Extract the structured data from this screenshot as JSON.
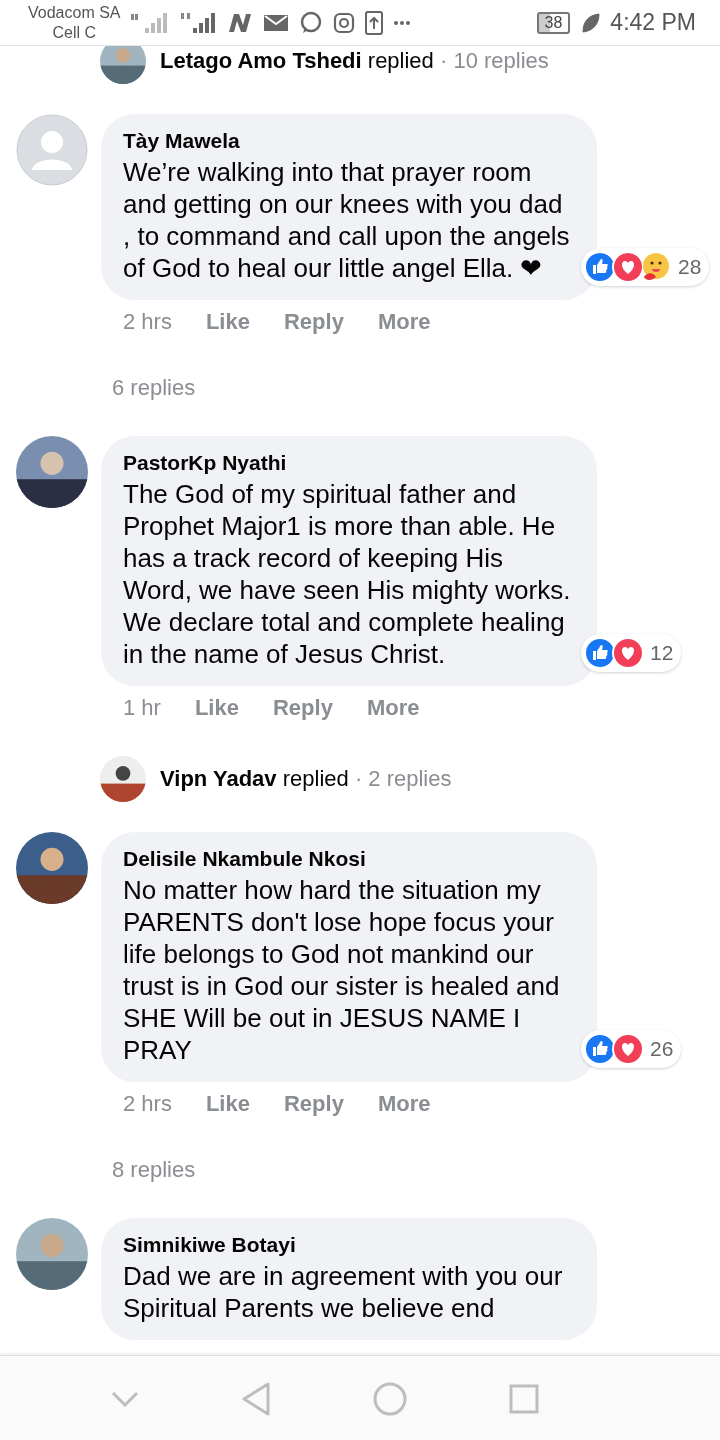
{
  "status_bar": {
    "carriers": [
      "Vodacom SA",
      "Cell C"
    ],
    "battery": "38",
    "time": "4:42 PM"
  },
  "feed": [
    {
      "kind": "reply_summary",
      "name": "Letago Amo Tshedi",
      "action": "replied",
      "count": "· 10 replies"
    },
    {
      "kind": "comment",
      "avatar": {
        "kind": "placeholder"
      },
      "author": "Tày Mawela",
      "text": "We’re walking into that prayer room and getting on our knees with you dad , to command and call upon the angels of God to heal our little angel Ella. ❤",
      "reactions": [
        {
          "kind": "like"
        },
        {
          "kind": "love"
        },
        {
          "kind": "care"
        }
      ],
      "reaction_count": "28",
      "time": "2 hrs",
      "actions": [
        "Like",
        "Reply",
        "More"
      ]
    },
    {
      "kind": "replies_link",
      "text": "6 replies"
    },
    {
      "kind": "comment",
      "avatar": {
        "kind": "picture"
      },
      "author": "PastorKp Nyathi",
      "text": "The God of my spiritual father and Prophet Major1 is more than able. He has a track record of keeping His Word, we have seen His mighty works. We declare total and complete healing in the name of Jesus Christ.",
      "reactions": [
        {
          "kind": "like"
        },
        {
          "kind": "love"
        }
      ],
      "reaction_count": "12",
      "time": "1 hr",
      "actions": [
        "Like",
        "Reply",
        "More"
      ]
    },
    {
      "kind": "reply_summary",
      "name": "Vipn Yadav",
      "action": "replied",
      "count": "· 2 replies"
    },
    {
      "kind": "comment",
      "avatar": {
        "kind": "picture"
      },
      "author": "Delisile Nkambule Nkosi",
      "text": "No matter how hard the situation my PARENTS don't lose hope focus your life belongs to God not mankind our trust is in God our sister is healed and SHE Will be out in JESUS NAME I PRAY",
      "reactions": [
        {
          "kind": "like"
        },
        {
          "kind": "love"
        }
      ],
      "reaction_count": "26",
      "time": "2 hrs",
      "actions": [
        "Like",
        "Reply",
        "More"
      ]
    },
    {
      "kind": "replies_link",
      "text": "8 replies"
    },
    {
      "kind": "comment",
      "avatar": {
        "kind": "picture"
      },
      "author": "Simnikiwe Botayi",
      "text": "Dad we are in agreement with you our Spiritual Parents we believe end"
    }
  ]
}
